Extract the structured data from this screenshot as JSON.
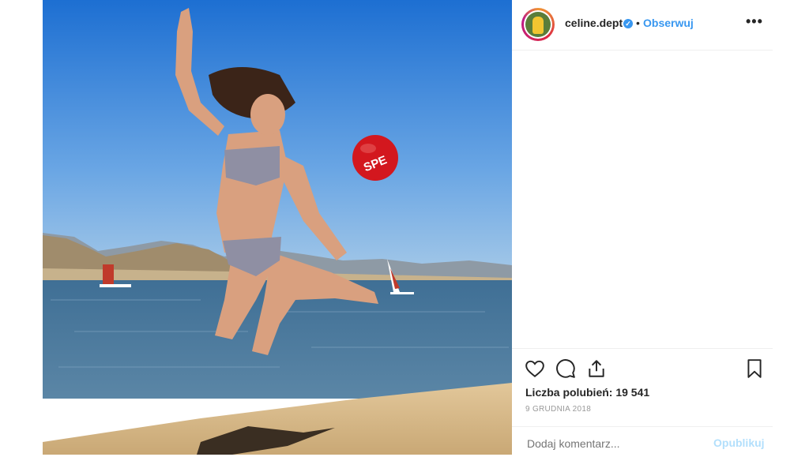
{
  "post": {
    "username": "celine.dept",
    "verified_mark": "✓",
    "separator": "•",
    "follow_label": "Obserwuj",
    "more_label": "•••",
    "likes_text": "Liczba polubień: 19 541",
    "date_text": "9 GRUDNIA 2018",
    "ball_text": "SPE"
  },
  "comment": {
    "placeholder": "Dodaj komentarz...",
    "publish_label": "Opublikuj"
  },
  "icons": {
    "like": "heart-icon",
    "comment": "comment-bubble-icon",
    "share": "share-upload-icon",
    "save": "bookmark-icon",
    "more": "more-options-icon"
  },
  "colors": {
    "accent": "#3897f0",
    "text": "#262626",
    "muted": "#999999",
    "publish_disabled": "#b2dffc"
  }
}
